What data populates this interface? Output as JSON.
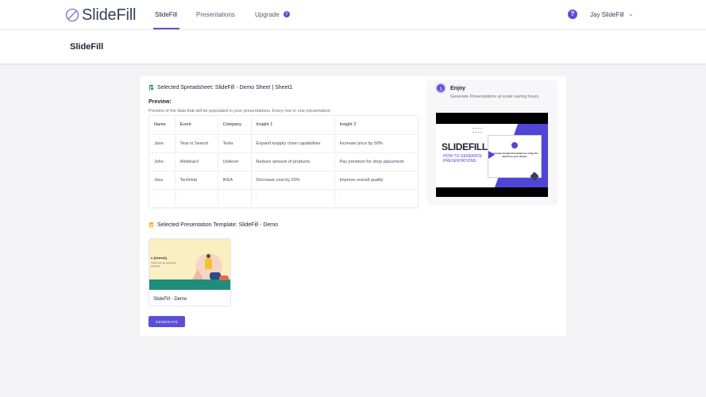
{
  "brand": {
    "name": "SlideFill",
    "accent": "#5a4fd6"
  },
  "nav": {
    "links": [
      "SlideFill",
      "Presentations",
      "Upgrade"
    ],
    "upgrade_badge": "i",
    "help": "?",
    "user": "Jay SlideFill",
    "user_chevron": "⌄"
  },
  "page": {
    "title": "SlideFill"
  },
  "spreadsheet": {
    "selected_label": "Selected Spreadsheet: SlideFill - Demo Sheet | Sheet1",
    "preview_title": "Preview:",
    "preview_desc": "Preview of the data that will be populated in your presentations. Every row in one presentation.",
    "columns": [
      "Name",
      "Event",
      "Company",
      "Insight 1",
      "Insight 2"
    ],
    "rows": [
      [
        "Jane",
        "Year in Search",
        "Tesla",
        "Expand tsupply chain capabilities",
        "Increase price by 50%"
      ],
      [
        "John",
        "WebinarX",
        "Unilever",
        "Reduce amount of products",
        "Pay premium for shop placement"
      ],
      [
        "Jess",
        "TechHub",
        "IKEA",
        "Decrease cost by 20%",
        "Improve overall quality"
      ],
      [
        ":",
        ":",
        ":",
        ":",
        ":"
      ]
    ]
  },
  "template": {
    "selected_label": "Selected Presentation Template: SlideFill - Demo",
    "thumb_heading": "n {{name}}",
    "thumb_sub": "Thank you for attending {{event}}",
    "name": "SlideFill - Demo"
  },
  "generate_label": "GENERATE",
  "enjoy": {
    "step": "3",
    "title": "Enjoy",
    "desc": "Generate Presentations at scale saving hours.",
    "video_big": "SLIDEFILL",
    "video_small": "HOW TO GENERATE PRESENTATIONS",
    "video_inner": "Generate Google Presentations using the data from your Sheets"
  }
}
